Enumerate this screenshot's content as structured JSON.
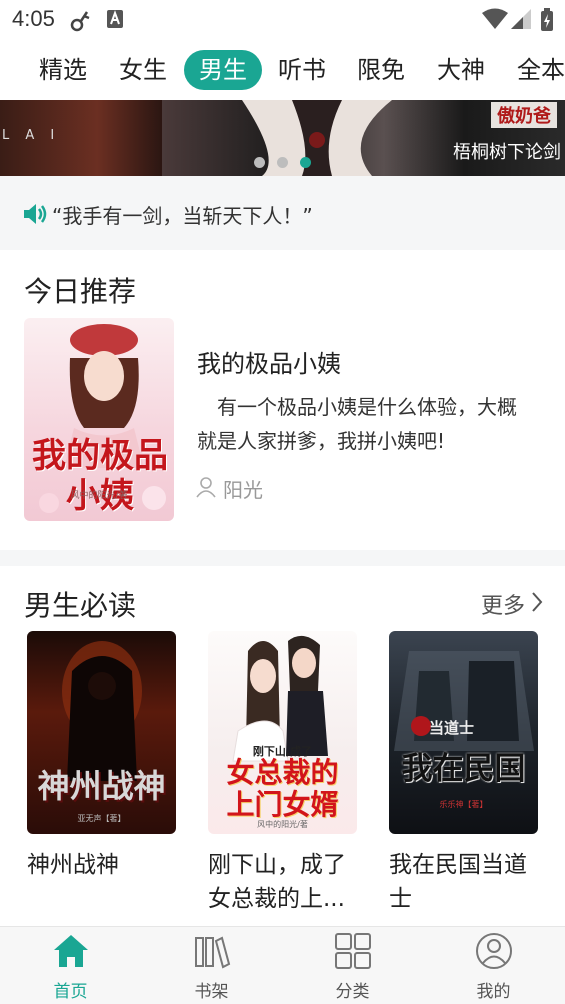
{
  "status": {
    "time": "4:05"
  },
  "tabs": [
    {
      "label": "精选",
      "active": false
    },
    {
      "label": "女生",
      "active": false
    },
    {
      "label": "男生",
      "active": true
    },
    {
      "label": "听书",
      "active": false
    },
    {
      "label": "限免",
      "active": false
    },
    {
      "label": "大神",
      "active": false
    },
    {
      "label": "全本",
      "active": false
    }
  ],
  "banner": {
    "title": "傲奶爸",
    "author": "梧桐树下论剑",
    "left_text": "L A I",
    "dots": 3,
    "active_dot": 3
  },
  "notice": {
    "icon": "speaker-icon",
    "text": "“我手有一剑，当斩天下人！”"
  },
  "today": {
    "title": "今日推荐",
    "book": {
      "title": "我的极品小姨",
      "desc": "　有一个极品小姨是什么体验，大概就是人家拼爹，我拼小姨吧!",
      "author": "阳光",
      "cover_text": "我的极品小姨",
      "cover_author": "风中的阳光/著"
    }
  },
  "must_read": {
    "title": "男生必读",
    "more": "更多",
    "books": [
      {
        "name": "神州战神",
        "cover_text": "神州战神",
        "cover_author": "亚无声【著】"
      },
      {
        "name": "刚下山，成了女总裁的上...",
        "cover_text": "女总裁的上门女婿",
        "cover_sub": "刚下山,成了",
        "cover_author": "风中的阳光/著"
      },
      {
        "name": "我在民国当道士",
        "cover_text": "我在民国",
        "cover_sub": "当道士",
        "cover_author": "乐乐神【著】"
      }
    ]
  },
  "nav": [
    {
      "label": "首页",
      "icon": "home-icon",
      "active": true
    },
    {
      "label": "书架",
      "icon": "bookshelf-icon",
      "active": false
    },
    {
      "label": "分类",
      "icon": "category-icon",
      "active": false
    },
    {
      "label": "我的",
      "icon": "profile-icon",
      "active": false
    }
  ],
  "colors": {
    "accent": "#1aa693",
    "text": "#222222",
    "muted": "#999999"
  }
}
